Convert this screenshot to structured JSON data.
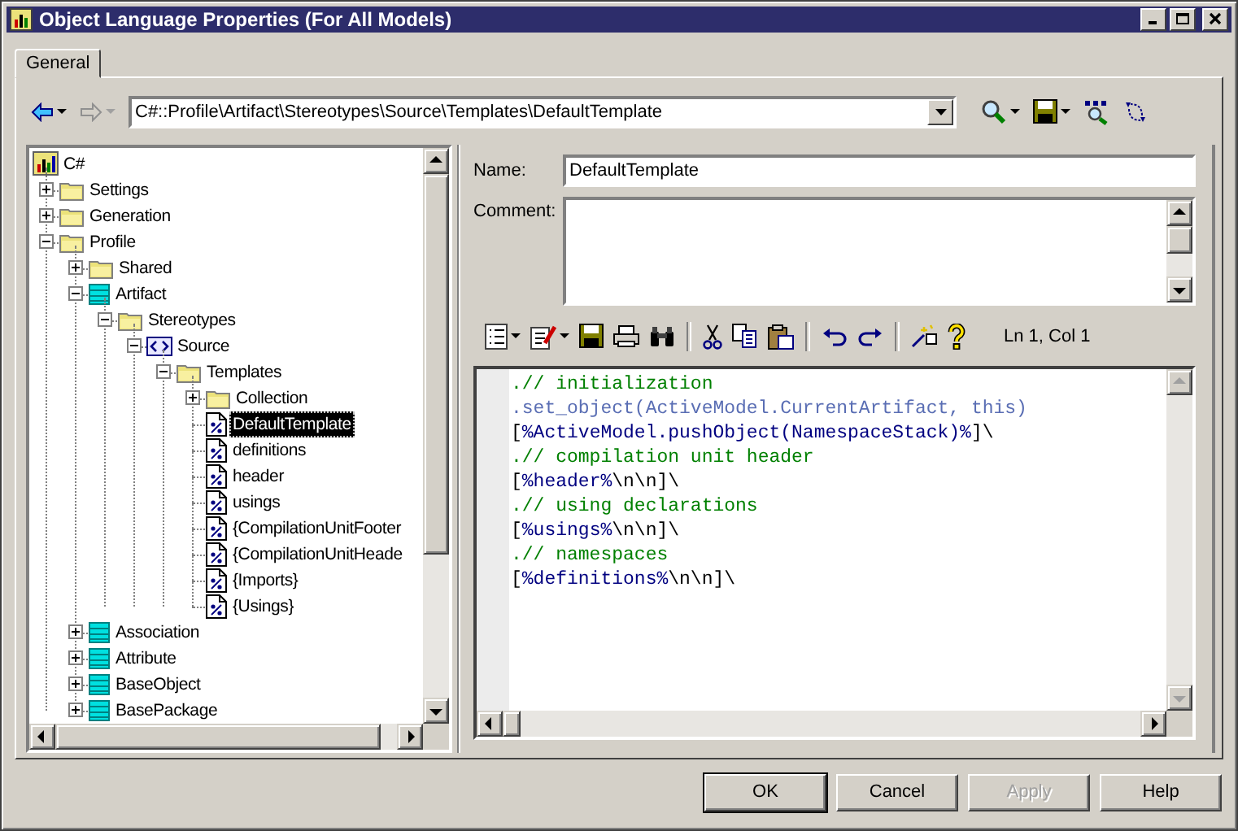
{
  "window": {
    "title": "Object Language Properties (For All Models)"
  },
  "tabs": [
    {
      "label": "General",
      "selected": true
    }
  ],
  "toolbar": {
    "nav": [
      {
        "kind": "back",
        "disabled": false
      },
      {
        "kind": "forward",
        "disabled": true
      }
    ],
    "path": "C#::Profile\\Artifact\\Stereotypes\\Source\\Templates\\DefaultTemplate",
    "tools": [
      {
        "kind": "find",
        "menu": true
      },
      {
        "kind": "save",
        "menu": true
      },
      {
        "kind": "spell",
        "menu": false
      },
      {
        "kind": "replace",
        "menu": false
      }
    ]
  },
  "tree": {
    "items": [
      {
        "label": "C#",
        "kind": "root",
        "selected": false,
        "children": [
          {
            "label": "Settings",
            "kind": "folder",
            "expanded": false,
            "selected": false
          },
          {
            "label": "Generation",
            "kind": "folder",
            "expanded": false,
            "selected": false
          },
          {
            "label": "Profile",
            "kind": "folder",
            "expanded": true,
            "selected": false,
            "children": [
              {
                "label": "Shared",
                "kind": "folder",
                "expanded": false,
                "selected": false
              },
              {
                "label": "Artifact",
                "kind": "class",
                "expanded": true,
                "selected": false,
                "children": [
                  {
                    "label": "Stereotypes",
                    "kind": "folder",
                    "expanded": true,
                    "selected": false,
                    "children": [
                      {
                        "label": "Source",
                        "kind": "stereotype",
                        "expanded": true,
                        "selected": false,
                        "children": [
                          {
                            "label": "Templates",
                            "kind": "folder",
                            "expanded": true,
                            "selected": false,
                            "children": [
                              {
                                "label": "Collection",
                                "kind": "folder",
                                "expanded": false,
                                "selected": false
                              },
                              {
                                "label": "DefaultTemplate",
                                "kind": "template",
                                "selected": true
                              },
                              {
                                "label": "definitions",
                                "kind": "template",
                                "selected": false
                              },
                              {
                                "label": "header",
                                "kind": "template",
                                "selected": false
                              },
                              {
                                "label": "usings",
                                "kind": "template",
                                "selected": false
                              },
                              {
                                "label": "{CompilationUnitFooter",
                                "kind": "template",
                                "selected": false
                              },
                              {
                                "label": "{CompilationUnitHeade",
                                "kind": "template",
                                "selected": false
                              },
                              {
                                "label": "{Imports}",
                                "kind": "template",
                                "selected": false
                              },
                              {
                                "label": "{Usings}",
                                "kind": "template",
                                "selected": false
                              }
                            ]
                          }
                        ]
                      }
                    ]
                  }
                ]
              },
              {
                "label": "Association",
                "kind": "class",
                "expanded": false,
                "selected": false
              },
              {
                "label": "Attribute",
                "kind": "class",
                "expanded": false,
                "selected": false
              },
              {
                "label": "BaseObject",
                "kind": "class",
                "expanded": false,
                "selected": false
              },
              {
                "label": "BasePackage",
                "kind": "class",
                "expanded": false,
                "selected": false
              }
            ]
          }
        ]
      }
    ]
  },
  "name_field": {
    "label": "Name:",
    "value": "DefaultTemplate"
  },
  "comment_field": {
    "label": "Comment:"
  },
  "editor": {
    "toolbar": [
      [
        {
          "kind": "list",
          "menu": true
        },
        {
          "kind": "properties",
          "menu": true
        },
        {
          "kind": "save",
          "menu": false
        },
        {
          "kind": "print",
          "menu": false
        },
        {
          "kind": "find",
          "menu": false
        }
      ],
      [
        {
          "kind": "cut",
          "menu": false
        },
        {
          "kind": "copy",
          "menu": false
        },
        {
          "kind": "paste",
          "menu": false
        }
      ],
      [
        {
          "kind": "undo",
          "menu": false
        },
        {
          "kind": "redo",
          "menu": false
        }
      ],
      [
        {
          "kind": "insert",
          "menu": false
        },
        {
          "kind": "help",
          "menu": false
        }
      ]
    ],
    "cursor": "Ln 1, Col 1",
    "lines": [
      [
        {
          "kind": "comment",
          "text": ".// initialization"
        }
      ],
      [
        {
          "kind": "macro",
          "text": ".set_object(ActiveModel.CurrentArtifact, this)"
        }
      ],
      [
        {
          "kind": "plain",
          "text": "["
        },
        {
          "kind": "var",
          "text": "%ActiveModel.pushObject(NamespaceStack)%"
        },
        {
          "kind": "plain",
          "text": "]\\"
        }
      ],
      [
        {
          "kind": "comment",
          "text": ".// compilation unit header"
        }
      ],
      [
        {
          "kind": "plain",
          "text": "["
        },
        {
          "kind": "var",
          "text": "%header%"
        },
        {
          "kind": "plain",
          "text": "\\n\\n]\\"
        }
      ],
      [
        {
          "kind": "comment",
          "text": ".// using declarations"
        }
      ],
      [
        {
          "kind": "plain",
          "text": "["
        },
        {
          "kind": "var",
          "text": "%usings%"
        },
        {
          "kind": "plain",
          "text": "\\n\\n]\\"
        }
      ],
      [
        {
          "kind": "comment",
          "text": ".// namespaces"
        }
      ],
      [
        {
          "kind": "plain",
          "text": "["
        },
        {
          "kind": "var",
          "text": "%definitions%"
        },
        {
          "kind": "plain",
          "text": "\\n\\n]\\"
        }
      ]
    ]
  },
  "buttons": [
    {
      "label": "OK",
      "default": true,
      "disabled": false
    },
    {
      "label": "Cancel",
      "default": false,
      "disabled": false
    },
    {
      "label": "Apply",
      "default": false,
      "disabled": true
    },
    {
      "label": "Help",
      "default": false,
      "disabled": false
    }
  ]
}
